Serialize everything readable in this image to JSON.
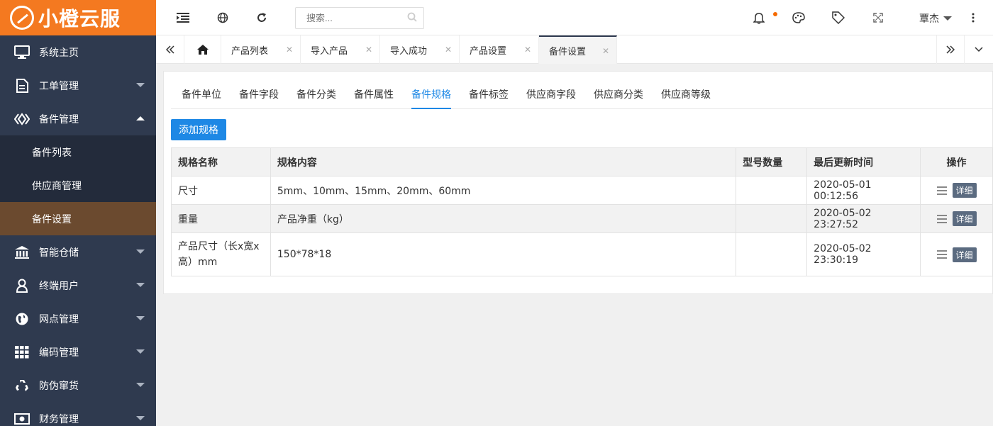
{
  "app": {
    "logo_text": "小橙云服"
  },
  "sidebar": {
    "items": [
      {
        "label": "系统主页",
        "icon": "monitor-icon"
      },
      {
        "label": "工单管理",
        "icon": "document-icon"
      },
      {
        "label": "备件管理",
        "icon": "parts-icon",
        "expanded": true
      },
      {
        "label": "智能仓储",
        "icon": "bank-icon"
      },
      {
        "label": "终端用户",
        "icon": "user-icon"
      },
      {
        "label": "网点管理",
        "icon": "globe-icon"
      },
      {
        "label": "编码管理",
        "icon": "grid-icon"
      },
      {
        "label": "防伪窜货",
        "icon": "recycle-icon"
      },
      {
        "label": "财务管理",
        "icon": "money-icon"
      }
    ],
    "submenu": [
      {
        "label": "备件列表"
      },
      {
        "label": "供应商管理"
      },
      {
        "label": "备件设置",
        "active": true
      }
    ]
  },
  "header": {
    "search_placeholder": "搜索...",
    "user_name": "覃杰",
    "has_notification": true
  },
  "tabs": [
    {
      "label": "产品列表"
    },
    {
      "label": "导入产品"
    },
    {
      "label": "导入成功"
    },
    {
      "label": "产品设置"
    },
    {
      "label": "备件设置",
      "active": true
    }
  ],
  "subtabs": [
    {
      "label": "备件单位"
    },
    {
      "label": "备件字段"
    },
    {
      "label": "备件分类"
    },
    {
      "label": "备件属性"
    },
    {
      "label": "备件规格",
      "active": true
    },
    {
      "label": "备件标签"
    },
    {
      "label": "供应商字段"
    },
    {
      "label": "供应商分类"
    },
    {
      "label": "供应商等级"
    }
  ],
  "add_button_label": "添加规格",
  "table": {
    "headers": [
      "规格名称",
      "规格内容",
      "型号数量",
      "最后更新时间",
      "操作"
    ],
    "detail_label": "详细",
    "rows": [
      {
        "name": "尺寸",
        "content": "5mm、10mm、15mm、20mm、60mm",
        "count": "",
        "updated": "2020-05-01 00:12:56"
      },
      {
        "name": "重量",
        "content": "产品净重（kg）",
        "count": "",
        "updated": "2020-05-02 23:27:52"
      },
      {
        "name": "产品尺寸（长x宽x高）mm",
        "content": "150*78*18",
        "count": "",
        "updated": "2020-05-02 23:30:19"
      }
    ]
  },
  "colors": {
    "brand_orange": "#f47920",
    "sidebar_bg": "#2f3a4f",
    "active_submenu_bg": "#6b4a2f",
    "accent_blue": "#1e88e5"
  }
}
